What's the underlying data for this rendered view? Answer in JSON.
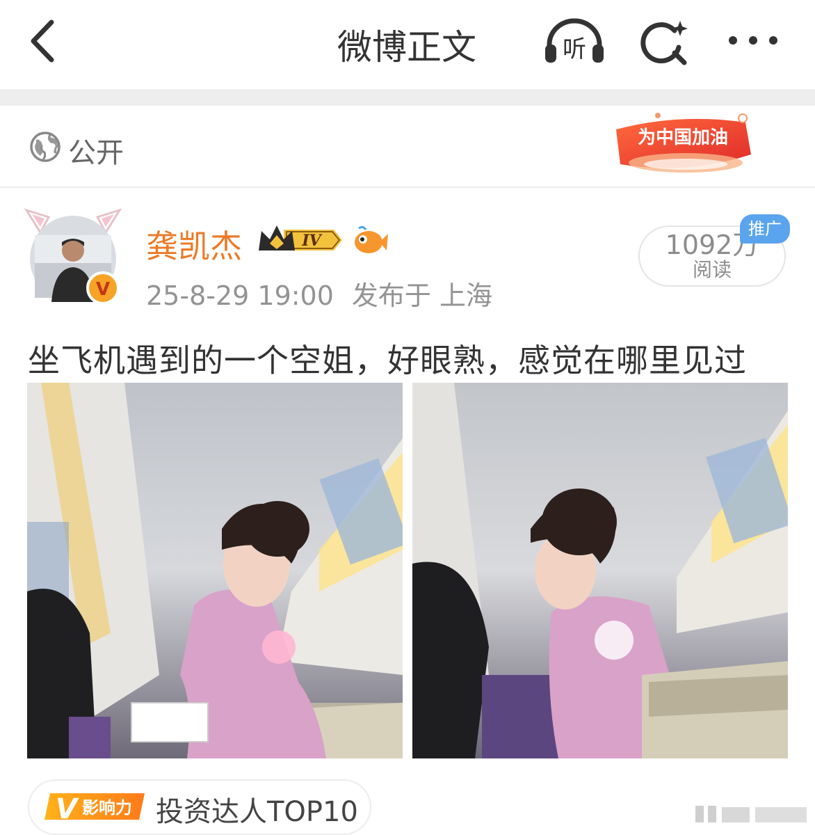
{
  "nav": {
    "title": "微博正文",
    "listen_icon_text": "听"
  },
  "visibility": {
    "label": "公开",
    "banner_text": "为中国加油"
  },
  "author": {
    "name": "龚凯杰",
    "level_text": "IV",
    "verified_mark": "V",
    "timestamp": "25-8-29 19:00",
    "location": "发布于 上海"
  },
  "stats": {
    "read_count": "1092万",
    "read_label": "阅读",
    "promo_tag": "推广"
  },
  "post": {
    "text": "坐飞机遇到的一个空姐，好眼熟，感觉在哪里见过",
    "images": [
      {
        "description": "空姐在机舱内分发餐食"
      },
      {
        "description": "空姐低头整理餐车"
      }
    ]
  },
  "influence": {
    "badge_text": "影响力",
    "badge_letter": "V",
    "label": "投资达人TOP10"
  },
  "colors": {
    "accent_orange": "#ec7a26",
    "promo_blue": "#5aa4ee",
    "banner_red": "#e8332e"
  },
  "icons": [
    "back-icon",
    "listen-icon",
    "search-icon",
    "more-icon",
    "globe-icon",
    "crown-icon",
    "fish-icon"
  ]
}
